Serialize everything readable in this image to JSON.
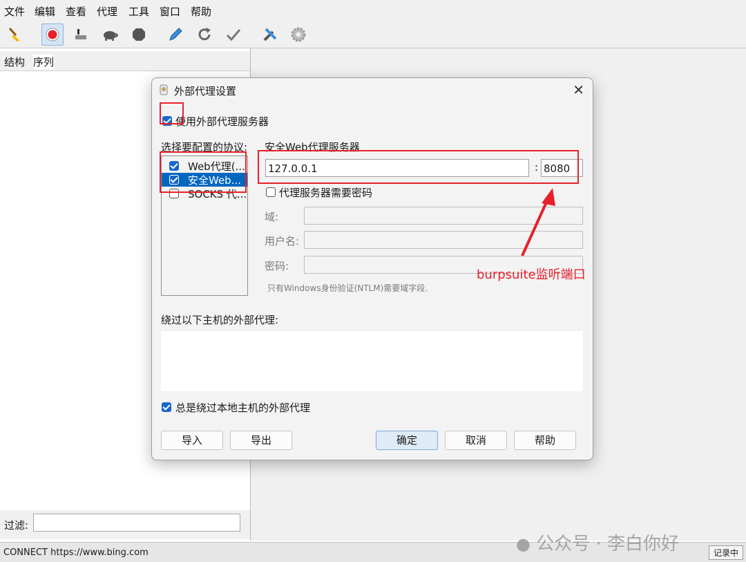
{
  "menu": [
    "文件",
    "编辑",
    "查看",
    "代理",
    "工具",
    "窗口",
    "帮助"
  ],
  "toolbar": [
    "broom-icon",
    "record-icon",
    "throttle-icon",
    "turtle-icon",
    "stop-icon",
    "edit-pen-icon",
    "repeat-icon",
    "validate-check-icon",
    "tools-icon",
    "settings-gear-icon"
  ],
  "left_tabs": [
    "结构",
    "序列"
  ],
  "filter": {
    "label": "过滤:",
    "value": ""
  },
  "status": {
    "text": "CONNECT https://www.bing.com",
    "recording": "记录中"
  },
  "dialog": {
    "title": "外部代理设置",
    "use_external": "使用外部代理服务器",
    "protocol_label": "选择要配置的协议:",
    "protocols": [
      {
        "label": "Web代理(...",
        "checked": true,
        "selected": false
      },
      {
        "label": "安全Web...",
        "checked": true,
        "selected": true
      },
      {
        "label": "SOCKS 代...",
        "checked": false,
        "selected": false
      }
    ],
    "server_label": "安全Web代理服务器",
    "host": "127.0.0.1",
    "colon": ":",
    "port": "8080",
    "needs_password": "代理服务器需要密码",
    "domain_label": "域:",
    "username_label": "用户名:",
    "password_label": "密码:",
    "ntlm_note": "只有Windows身份验证(NTLM)需要域字段.",
    "bypass_label": "绕过以下主机的外部代理:",
    "bypass_value": "",
    "always_bypass_local": "总是绕过本地主机的外部代理",
    "buttons": {
      "import": "导入",
      "export": "导出",
      "ok": "确定",
      "cancel": "取消",
      "help": "帮助"
    }
  },
  "annotation": "burpsuite监听端口",
  "watermark": "公众号 · 李白你好",
  "colors": {
    "annotation_red": "#e8202a",
    "accent_blue": "#1a66c9"
  }
}
